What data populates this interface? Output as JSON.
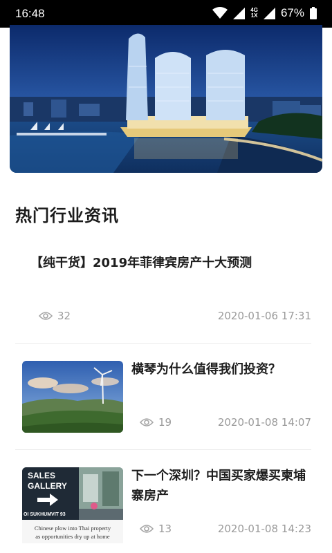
{
  "status_bar": {
    "time": "16:48",
    "network_top": "4G",
    "network_bottom": "1X",
    "battery_pct": "67%",
    "icons": [
      "wifi-icon",
      "signal-icon",
      "signal-4g-icon",
      "battery-icon"
    ]
  },
  "banner": {
    "image": "city-skyline-towers-by-sea"
  },
  "section": {
    "title": "热门行业资讯"
  },
  "news": [
    {
      "title": "【纯干货】2019年菲律宾房产十大预测",
      "views": "32",
      "date": "2020-01-06 17:31",
      "thumbnail": ""
    },
    {
      "title": "横琴为什么值得我们投资？",
      "views": "19",
      "date": "2020-01-08 14:07",
      "thumbnail": "wind-turbine-hills"
    },
    {
      "title": "下一个深圳？中国买家爆买柬埔寨房产",
      "views": "13",
      "date": "2020-01-08 14:23",
      "thumbnail": "sales-gallery-newspaper"
    }
  ],
  "thumb_text": {
    "sales_line1": "SALES",
    "sales_line2": "GALLERY",
    "street": "OI SUKHUMVIT 93",
    "caption1": "Chinese plow into Thai property",
    "caption2": "as opportunities dry up at home"
  },
  "colors": {
    "status_bar_bg": "#000000",
    "meta_gray": "#9a9a9a",
    "title_dark": "#1e1e1e"
  }
}
